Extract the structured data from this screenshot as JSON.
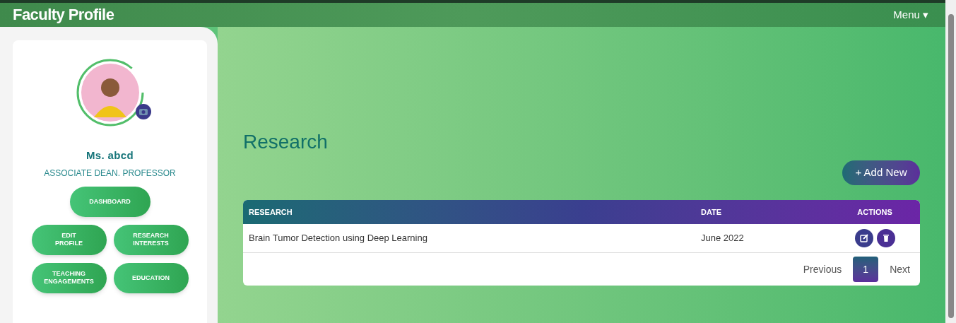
{
  "header": {
    "title": "Faculty Profile",
    "menu": "Menu ▾"
  },
  "profile": {
    "name": "Ms. abcd",
    "role": "ASSOCIATE DEAN. PROFESSOR"
  },
  "nav": [
    {
      "label": "DASHBOARD"
    },
    {
      "label": "EDIT\nPROFILE"
    },
    {
      "label": "RESEARCH\nINTERESTS"
    },
    {
      "label": "TEACHING\nENGAGEMENTS"
    },
    {
      "label": "EDUCATION"
    }
  ],
  "page": {
    "title": "Research",
    "add_button": "+ Add New"
  },
  "table": {
    "columns": [
      "RESEARCH",
      "DATE",
      "ACTIONS"
    ],
    "rows": [
      {
        "research": "Brain Tumor Detection using Deep Learning",
        "date": "June 2022"
      }
    ]
  },
  "pagination": [
    {
      "label": "Previous",
      "selected": false
    },
    {
      "label": "1",
      "selected": true
    },
    {
      "label": "Next",
      "selected": false
    }
  ]
}
